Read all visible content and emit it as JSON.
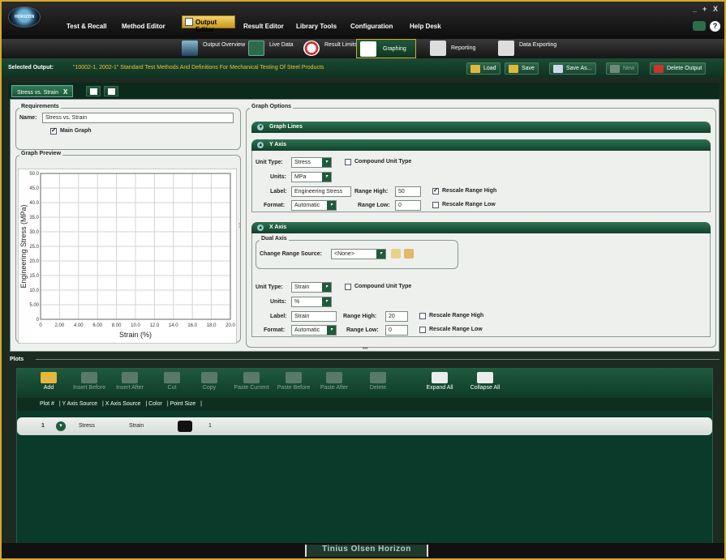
{
  "app": {
    "window_controls": [
      "_",
      "+",
      "X"
    ],
    "menu": [
      "Test & Recall",
      "Method Editor",
      "Output Editor",
      "Result Editor",
      "Library Tools",
      "Configuration",
      "Help Desk"
    ],
    "help_glyph": "?"
  },
  "subtoolbar": [
    {
      "label": "Output Overview",
      "icon": "output-overview-icon"
    },
    {
      "label": "Live Data",
      "icon": "live-data-icon"
    },
    {
      "label": "Result Limits",
      "icon": "result-limits-icon"
    },
    {
      "label": "Graphing",
      "icon": "graphing-icon",
      "active": true
    },
    {
      "label": "Reporting",
      "icon": "reporting-icon"
    },
    {
      "label": "Data Exporting",
      "icon": "data-exporting-icon"
    }
  ],
  "selected_output": {
    "label": "Selected Output:",
    "value": "\"10002-1, 2002-1\" Standard Test Methods And Definitions For Mechanical Testing Of Steel Products"
  },
  "toolbar": {
    "load": "Load",
    "save": "Save",
    "save_as": "Save As...",
    "new": "New",
    "delete_output": "Delete Output"
  },
  "tab": {
    "label": "Stress vs. Strain",
    "close": "X"
  },
  "requirements": {
    "title": "Requirements",
    "name_label": "Name:",
    "name_value": "Stress vs. Strain",
    "main_graph_label": "Main Graph",
    "main_graph_checked": true
  },
  "graph_preview": {
    "title": "Graph Preview"
  },
  "chart_data": {
    "type": "line",
    "title": "",
    "xlabel": "Strain (%)",
    "ylabel": "Engineering Stress (MPa)",
    "xlim": [
      0,
      20
    ],
    "ylim": [
      0,
      50
    ],
    "x_ticks": [
      "0",
      "2.00",
      "4.00",
      "6.00",
      "8.00",
      "10.0",
      "12.0",
      "14.0",
      "16.0",
      "18.0",
      "20.0"
    ],
    "y_ticks": [
      "0",
      "5.00",
      "10.0",
      "15.0",
      "20.0",
      "25.0",
      "30.0",
      "35.0",
      "40.0",
      "45.0",
      "50.0"
    ],
    "grid": true,
    "series": []
  },
  "graph_options": {
    "title": "Graph Options",
    "graph_lines": "Graph Lines",
    "y_axis": {
      "title": "Y Axis",
      "unit_type_label": "Unit Type:",
      "unit_type": "Stress",
      "compound_label": "Compound Unit Type",
      "compound_checked": false,
      "units_label": "Units:",
      "units": "MPa",
      "label_label": "Label:",
      "label": "Engineering Stress",
      "range_high_label": "Range High:",
      "range_high": "50",
      "rescale_high_label": "Rescale Range High",
      "rescale_high_checked": true,
      "format_label": "Format:",
      "format": "Automatic",
      "range_low_label": "Range Low:",
      "range_low": "0",
      "rescale_low_label": "Rescale Range Low",
      "rescale_low_checked": false
    },
    "x_axis": {
      "title": "X Axis",
      "dual_axis_title": "Dual Axis",
      "change_range_label": "Change Range Source:",
      "change_range": "<None>",
      "unit_type_label": "Unit Type:",
      "unit_type": "Strain",
      "compound_label": "Compound Unit Type",
      "compound_checked": false,
      "units_label": "Units:",
      "units": "%",
      "label_label": "Label:",
      "label": "Strain",
      "range_high_label": "Range High:",
      "range_high": "20",
      "rescale_high_label": "Rescale Range High",
      "rescale_high_checked": false,
      "format_label": "Format:",
      "format": "Automatic",
      "range_low_label": "Range Low:",
      "range_low": "0",
      "rescale_low_label": "Rescale Range Low",
      "rescale_low_checked": false
    }
  },
  "plots": {
    "title": "Plots",
    "toolbar": [
      {
        "label": "Add",
        "enabled": true
      },
      {
        "label": "Insert Before",
        "enabled": false
      },
      {
        "label": "Insert After",
        "enabled": false
      },
      {
        "label": "Cut",
        "enabled": false
      },
      {
        "label": "Copy",
        "enabled": false
      },
      {
        "label": "Paste Current",
        "enabled": false
      },
      {
        "label": "Paste Before",
        "enabled": false
      },
      {
        "label": "Paste After",
        "enabled": false
      },
      {
        "label": "Delete",
        "enabled": false
      },
      {
        "label": "Expand All",
        "enabled": true
      },
      {
        "label": "Collapse All",
        "enabled": true
      }
    ],
    "columns": [
      "Plot #",
      "| Y Axis Source",
      "| X Axis Source",
      "| Color",
      "| Point Size",
      "|"
    ],
    "rows": [
      {
        "num": "1",
        "y_source": "Stress",
        "x_source": "Strain",
        "color": "#111111",
        "point_size": "1"
      }
    ]
  },
  "footer": {
    "brand": "Tinius Olsen Horizon"
  },
  "colors": {
    "accent": "#d7a92a",
    "panel_green": "#1f5a3a",
    "dark_green": "#0a3a2a"
  }
}
